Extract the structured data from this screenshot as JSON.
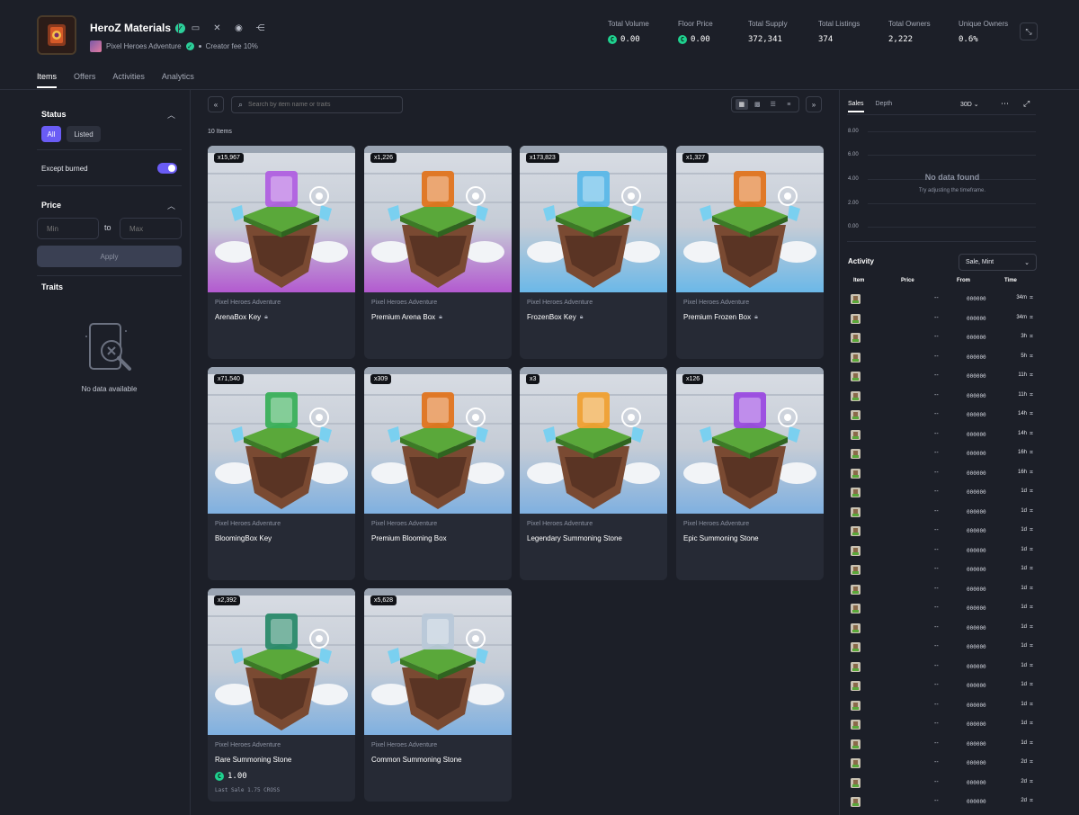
{
  "collection": {
    "name": "HeroZ Materials",
    "parent": "Pixel Heroes Adventure",
    "creator_fee": "Creator fee 10%"
  },
  "stats": [
    {
      "label": "Total Volume",
      "value": "0.00",
      "coin": true
    },
    {
      "label": "Floor Price",
      "value": "0.00",
      "coin": true
    },
    {
      "label": "Total Supply",
      "value": "372,341",
      "coin": false
    },
    {
      "label": "Total Listings",
      "value": "374",
      "coin": false
    },
    {
      "label": "Total Owners",
      "value": "2,222",
      "coin": false
    },
    {
      "label": "Unique Owners",
      "value": "0.6%",
      "coin": false
    }
  ],
  "tabs": [
    "Items",
    "Offers",
    "Activities",
    "Analytics"
  ],
  "sidebar": {
    "status_title": "Status",
    "status_all": "All",
    "status_listed": "Listed",
    "except_burned": "Except burned",
    "price_title": "Price",
    "min_placeholder": "Min",
    "to": "to",
    "max_placeholder": "Max",
    "apply": "Apply",
    "traits_title": "Traits",
    "no_data": "No data available"
  },
  "toolbar": {
    "search_placeholder": "Search by item name or traits",
    "items_count": "10 Items"
  },
  "items": [
    {
      "qty": "x15,967",
      "collection": "Pixel Heroes Adventure",
      "name": "ArenaBox Key",
      "locked": true,
      "accent": "#b060e0",
      "bg": "#b35ad0"
    },
    {
      "qty": "x1,226",
      "collection": "Pixel Heroes Adventure",
      "name": "Premium Arena Box",
      "locked": true,
      "accent": "#e0741e",
      "bg": "#b35ad0"
    },
    {
      "qty": "x173,823",
      "collection": "Pixel Heroes Adventure",
      "name": "FrozenBox Key",
      "locked": true,
      "accent": "#5ab8e8",
      "bg": "#6bb8e8"
    },
    {
      "qty": "x1,327",
      "collection": "Pixel Heroes Adventure",
      "name": "Premium Frozen Box",
      "locked": true,
      "accent": "#e0741e",
      "bg": "#6bb8e8"
    },
    {
      "qty": "x71,540",
      "collection": "Pixel Heroes Adventure",
      "name": "BloomingBox Key",
      "locked": false,
      "accent": "#3ab05a",
      "bg": "#7fb0e0"
    },
    {
      "qty": "x309",
      "collection": "Pixel Heroes Adventure",
      "name": "Premium Blooming Box",
      "locked": false,
      "accent": "#e0741e",
      "bg": "#7fb0e0"
    },
    {
      "qty": "x3",
      "collection": "Pixel Heroes Adventure",
      "name": "Legendary Summoning Stone",
      "locked": false,
      "accent": "#f0a030",
      "bg": "#7fb0e0"
    },
    {
      "qty": "x126",
      "collection": "Pixel Heroes Adventure",
      "name": "Epic Summoning Stone",
      "locked": false,
      "accent": "#9a4ae0",
      "bg": "#7fb0e0"
    },
    {
      "qty": "x2,392",
      "collection": "Pixel Heroes Adventure",
      "name": "Rare Summoning Stone",
      "locked": false,
      "accent": "#2a8a6a",
      "bg": "#7fb0e0",
      "price": "1.00",
      "last_sale": "Last Sale 1.75 CROSS"
    },
    {
      "qty": "x5,628",
      "collection": "Pixel Heroes Adventure",
      "name": "Common Summoning Stone",
      "locked": false,
      "accent": "#b8c8d8",
      "bg": "#7fb0e0"
    }
  ],
  "sales_panel": {
    "tab_sales": "Sales",
    "tab_depth": "Depth",
    "range": "30D",
    "y_ticks": [
      "8.00",
      "6.00",
      "4.00",
      "2.00",
      "0.00"
    ],
    "no_data_title": "No data found",
    "no_data_sub": "Try adjusting the timeframe."
  },
  "activity": {
    "title": "Activity",
    "filter": "Sale, Mint",
    "headers": {
      "item": "Item",
      "price": "Price",
      "from": "From",
      "time": "Time"
    },
    "rows": [
      {
        "price": "--",
        "from": "000000",
        "time": "34m"
      },
      {
        "price": "--",
        "from": "000000",
        "time": "34m"
      },
      {
        "price": "--",
        "from": "000000",
        "time": "3h"
      },
      {
        "price": "--",
        "from": "000000",
        "time": "5h"
      },
      {
        "price": "--",
        "from": "000000",
        "time": "11h"
      },
      {
        "price": "--",
        "from": "000000",
        "time": "11h"
      },
      {
        "price": "--",
        "from": "000000",
        "time": "14h"
      },
      {
        "price": "--",
        "from": "000000",
        "time": "14h"
      },
      {
        "price": "--",
        "from": "000000",
        "time": "16h"
      },
      {
        "price": "--",
        "from": "000000",
        "time": "16h"
      },
      {
        "price": "--",
        "from": "000000",
        "time": "1d"
      },
      {
        "price": "--",
        "from": "000000",
        "time": "1d"
      },
      {
        "price": "--",
        "from": "000000",
        "time": "1d"
      },
      {
        "price": "--",
        "from": "000000",
        "time": "1d"
      },
      {
        "price": "--",
        "from": "000000",
        "time": "1d"
      },
      {
        "price": "--",
        "from": "000000",
        "time": "1d"
      },
      {
        "price": "--",
        "from": "000000",
        "time": "1d"
      },
      {
        "price": "--",
        "from": "000000",
        "time": "1d"
      },
      {
        "price": "--",
        "from": "000000",
        "time": "1d"
      },
      {
        "price": "--",
        "from": "000000",
        "time": "1d"
      },
      {
        "price": "--",
        "from": "000000",
        "time": "1d"
      },
      {
        "price": "--",
        "from": "000000",
        "time": "1d"
      },
      {
        "price": "--",
        "from": "000000",
        "time": "1d"
      },
      {
        "price": "--",
        "from": "000000",
        "time": "1d"
      },
      {
        "price": "--",
        "from": "000000",
        "time": "2d"
      },
      {
        "price": "--",
        "from": "000000",
        "time": "2d"
      },
      {
        "price": "--",
        "from": "000000",
        "time": "2d"
      }
    ]
  },
  "icons": {
    "youtube": "youtube-icon",
    "x": "x-icon",
    "discord": "discord-icon",
    "share": "share-icon"
  },
  "colors": {
    "accent": "#6a5cf5",
    "coin": "#1fd18f",
    "verified": "#2ccf9a"
  }
}
